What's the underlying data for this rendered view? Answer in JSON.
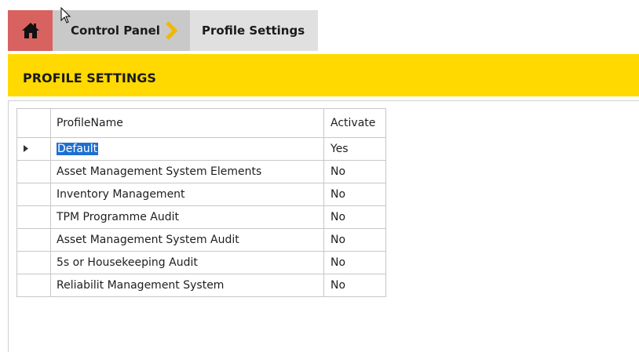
{
  "breadcrumb": {
    "home_icon": "home-icon",
    "items": [
      {
        "label": "Control Panel"
      },
      {
        "label": "Profile Settings"
      }
    ],
    "separator_icon": "chevron-right-icon"
  },
  "header": {
    "title": "PROFILE SETTINGS"
  },
  "grid": {
    "columns": [
      "ProfileName",
      "Activate"
    ],
    "rows": [
      {
        "ProfileName": "Default",
        "Activate": "Yes"
      },
      {
        "ProfileName": "Asset Management System Elements",
        "Activate": "No"
      },
      {
        "ProfileName": "Inventory Management",
        "Activate": "No"
      },
      {
        "ProfileName": "TPM Programme Audit",
        "Activate": "No"
      },
      {
        "ProfileName": "Asset Management System Audit",
        "Activate": "No"
      },
      {
        "ProfileName": "5s or Housekeeping Audit",
        "Activate": "No"
      },
      {
        "ProfileName": "Reliabilit Management System",
        "Activate": "No"
      }
    ],
    "current_row_index": 0
  },
  "colors": {
    "home_bg": "#d8625f",
    "accent_yellow": "#ffd900",
    "chevron": "#f2b705",
    "selection": "#1f6fd1"
  }
}
